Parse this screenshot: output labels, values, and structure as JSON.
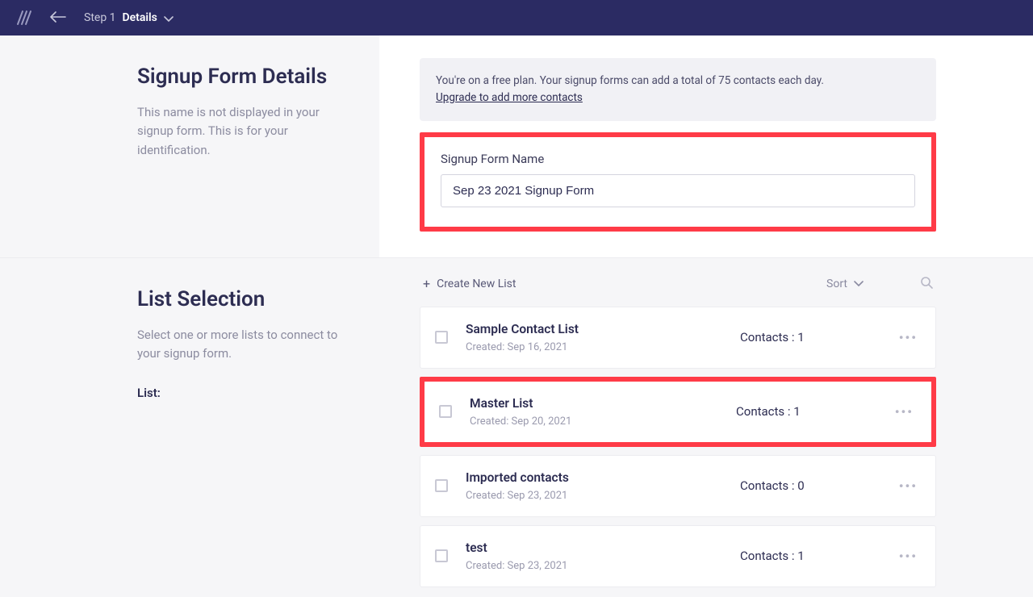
{
  "topbar": {
    "step_label": "Step 1",
    "step_name": "Details"
  },
  "details": {
    "heading": "Signup Form Details",
    "description": "This name is not displayed in your signup form. This is for your identification.",
    "notice_line1": "You're on a free plan. Your signup forms can add a total of 75 contacts each day.",
    "notice_link": "Upgrade to add more contacts",
    "field_label": "Signup Form Name",
    "field_value": "Sep 23 2021 Signup Form"
  },
  "lists": {
    "heading": "List Selection",
    "description": "Select one or more lists to connect to your signup form.",
    "list_label": "List:",
    "create_label": "Create New List",
    "sort_label": "Sort",
    "contacts_label": "Contacts",
    "created_label": "Created",
    "items": [
      {
        "name": "Sample Contact List",
        "created": "Sep 16, 2021",
        "contacts": 1,
        "highlight": false
      },
      {
        "name": "Master List",
        "created": "Sep 20, 2021",
        "contacts": 1,
        "highlight": true
      },
      {
        "name": "Imported contacts",
        "created": "Sep 23, 2021",
        "contacts": 0,
        "highlight": false
      },
      {
        "name": "test",
        "created": "Sep 23, 2021",
        "contacts": 1,
        "highlight": false
      }
    ]
  }
}
